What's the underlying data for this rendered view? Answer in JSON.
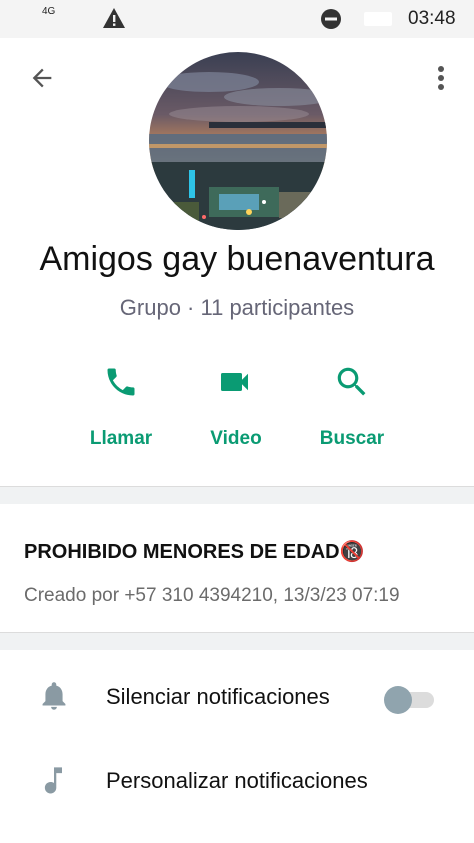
{
  "status_bar": {
    "network": "4G",
    "time": "03:48"
  },
  "header": {
    "back_icon": "arrow-back-icon",
    "menu_icon": "more-vert-icon"
  },
  "group": {
    "name": "Amigos gay buenaventura",
    "subtitle": "Grupo · 11 participantes"
  },
  "actions": [
    {
      "label": "Llamar",
      "icon": "phone-icon"
    },
    {
      "label": "Video",
      "icon": "video-icon"
    },
    {
      "label": "Buscar",
      "icon": "search-icon"
    }
  ],
  "description": {
    "title": "PROHIBIDO MENORES DE EDAD🔞",
    "created_by": "Creado por +57 310 4394210, 13/3/23 07:19"
  },
  "settings": [
    {
      "label": "Silenciar notificaciones",
      "icon": "bell-icon",
      "toggle_on": false
    },
    {
      "label": "Personalizar notificaciones",
      "icon": "music-note-icon"
    }
  ],
  "colors": {
    "accent": "#0a9b73",
    "secondary_text": "#667",
    "icon_gray": "#8a9aa3"
  }
}
